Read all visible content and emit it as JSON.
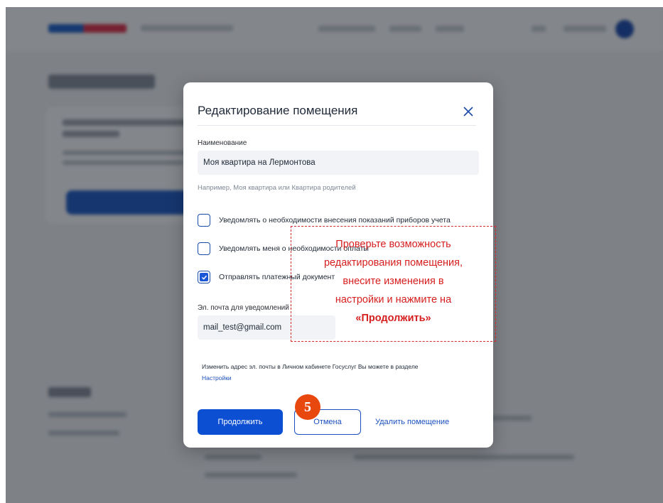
{
  "modal": {
    "title": "Редактирование помещения",
    "name_label": "Наименование",
    "name_value": "Моя квартира на Лермонтова",
    "name_hint": "Например, Моя квартира или Квартира родителей",
    "checkboxes": [
      {
        "label": "Уведомлять о необходимости внесения показаний приборов учета",
        "checked": false
      },
      {
        "label": "Уведомлять меня о необходимости оплаты",
        "checked": false
      },
      {
        "label": "Отправлять платежный документ",
        "checked": true
      }
    ],
    "email_label": "Эл. почта для уведомлений",
    "email_value": "mail_test@gmail.com",
    "info_text": "Изменить адрес эл. почты в Личном кабинете Госуслуг Вы можете в разделе",
    "info_link": "Настройки",
    "continue_label": "Продолжить",
    "cancel_label": "Отмена",
    "delete_label": "Удалить помещение"
  },
  "step_number": "5",
  "callout": {
    "lines": [
      "Проверьте возможность",
      "редактирования помещения,",
      "внесите изменения в",
      "настройки и нажмите на"
    ],
    "emphasis": "«Продолжить»"
  },
  "colors": {
    "primary": "#0d4fd3",
    "callout": "#d61e1e",
    "badge": "#e8470d"
  }
}
